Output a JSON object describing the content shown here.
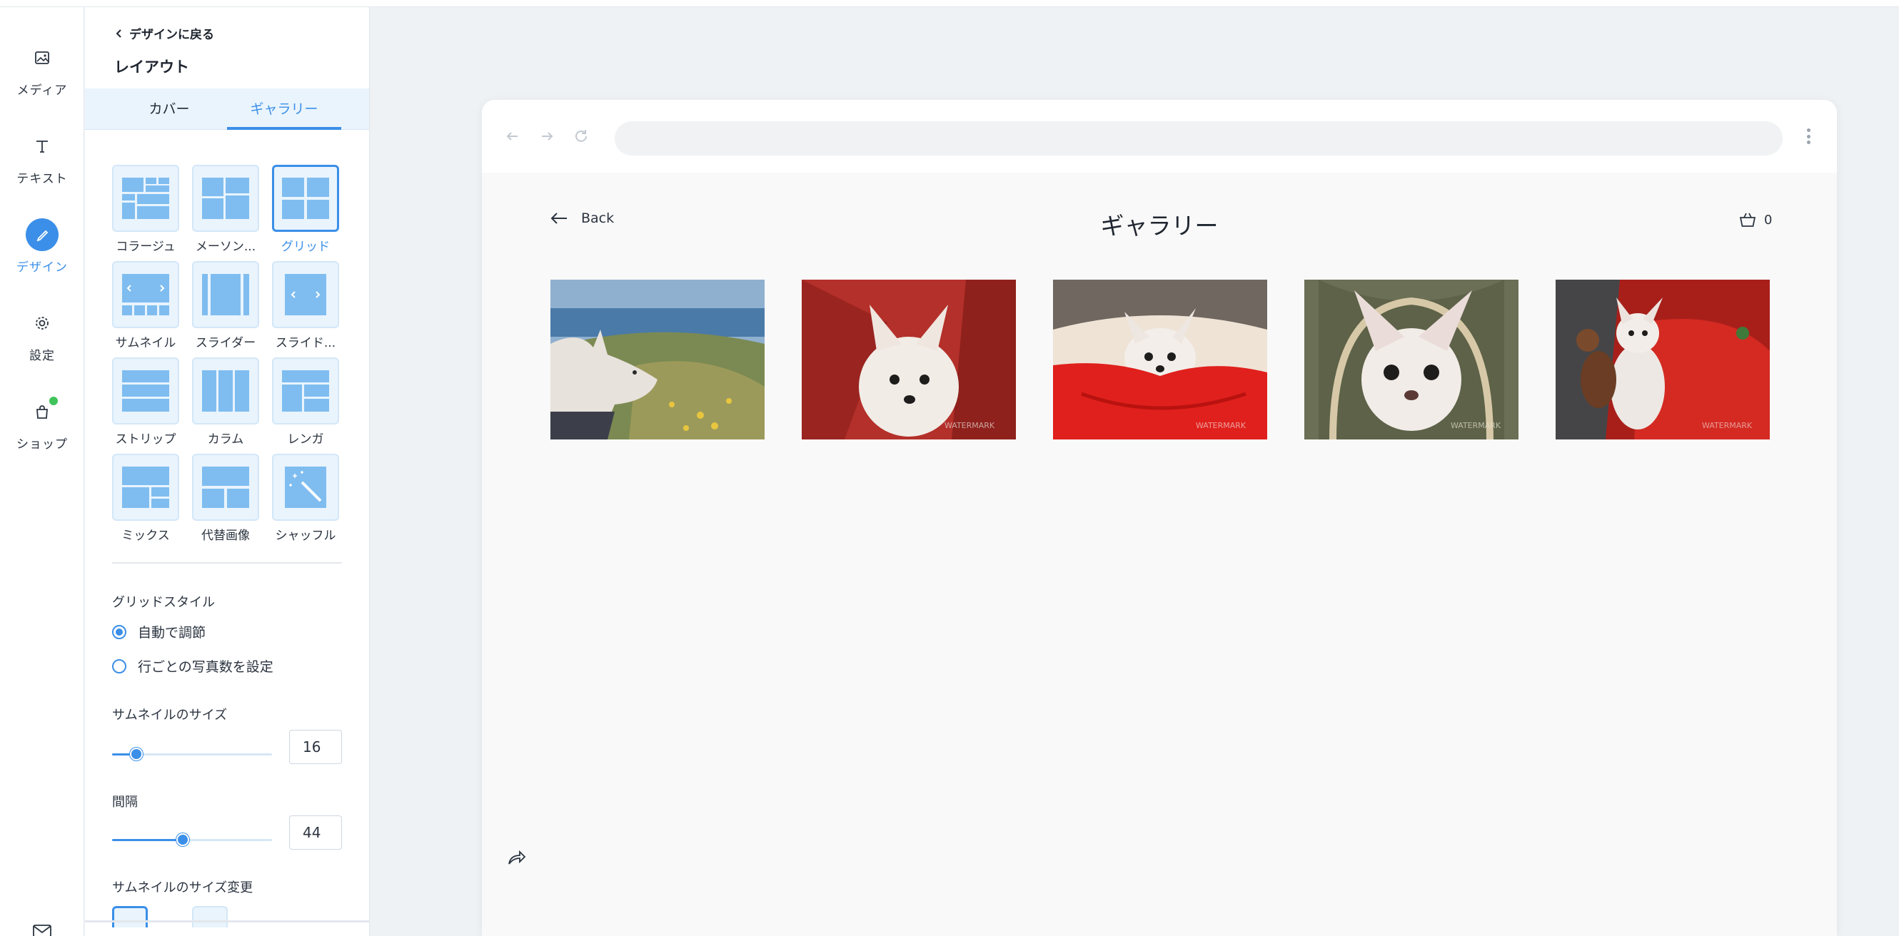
{
  "rail": {
    "items": [
      {
        "label": "メディア",
        "icon": "image-icon"
      },
      {
        "label": "テキスト",
        "icon": "text-icon"
      },
      {
        "label": "デザイン",
        "icon": "brush-icon"
      },
      {
        "label": "設定",
        "icon": "gear-icon"
      },
      {
        "label": "ショップ",
        "icon": "bag-icon"
      }
    ],
    "accent": "#3b8fe8",
    "notification_color": "#3fc35a"
  },
  "panel": {
    "back_label": "デザインに戻る",
    "title": "レイアウト",
    "tabs": [
      "カバー",
      "ギャラリー"
    ],
    "active_tab": "ギャラリー",
    "layouts": [
      "コラージュ",
      "メーソン...",
      "グリッド",
      "サムネイル",
      "スライダー",
      "スライド...",
      "ストリップ",
      "カラム",
      "レンガ",
      "ミックス",
      "代替画像",
      "シャッフル"
    ],
    "selected_layout": "グリッド",
    "grid_style": {
      "label": "グリッドスタイル",
      "options": [
        "自動で調節",
        "行ごとの写真数を設定"
      ],
      "selected": "自動で調節"
    },
    "thumb_size": {
      "label": "サムネイルのサイズ",
      "value": "16",
      "fraction": 0.15
    },
    "spacing": {
      "label": "間隔",
      "value": "44",
      "fraction": 0.44
    },
    "resize_label": "サムネイルのサイズ変更"
  },
  "preview": {
    "back_label": "Back",
    "title": "ギャラリー",
    "cart_count": "0"
  }
}
